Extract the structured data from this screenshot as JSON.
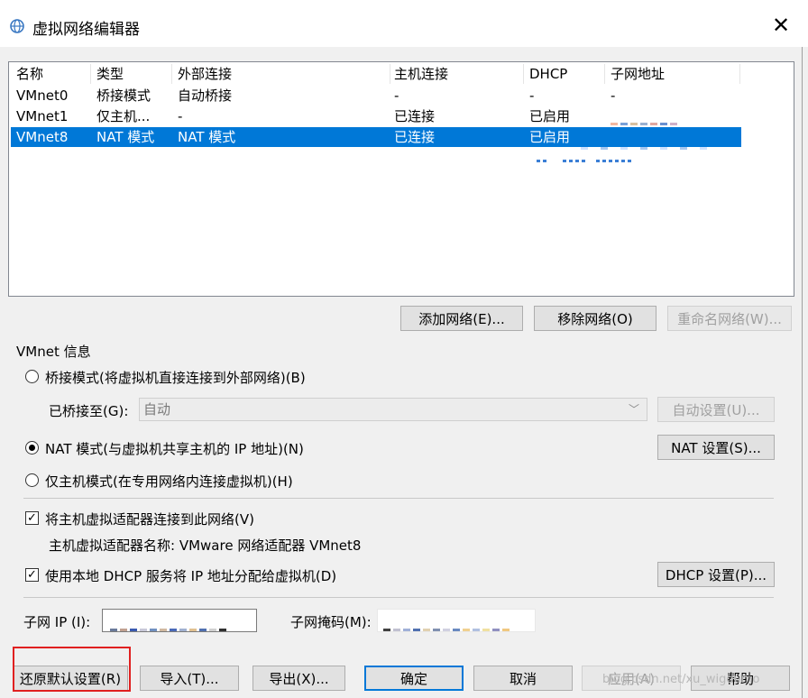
{
  "window": {
    "title": "虚拟网络编辑器",
    "close_glyph": "✕",
    "icon": "network-editor-icon"
  },
  "list": {
    "columns": [
      "名称",
      "类型",
      "外部连接",
      "主机连接",
      "DHCP",
      "子网地址"
    ],
    "rows": [
      {
        "name": "VMnet0",
        "type": "桥接模式",
        "external": "自动桥接",
        "host": "-",
        "dhcp": "-",
        "subnet": "-"
      },
      {
        "name": "VMnet1",
        "type": "仅主机...",
        "external": "-",
        "host": "已连接",
        "dhcp": "已启用",
        "subnet": ""
      },
      {
        "name": "VMnet8",
        "type": "NAT 模式",
        "external": "NAT 模式",
        "host": "已连接",
        "dhcp": "已启用",
        "subnet": ""
      }
    ],
    "selected_index": 2
  },
  "net_buttons": {
    "add": "添加网络(E)...",
    "remove": "移除网络(O)",
    "rename": "重命名网络(W)..."
  },
  "vmnet_info": {
    "group_title": "VMnet 信息",
    "bridge_label": "桥接模式(将虚拟机直接连接到外部网络)(B)",
    "bridged_to_label": "已桥接至(G):",
    "bridged_to_value": "自动",
    "auto_settings": "自动设置(U)...",
    "nat_label": "NAT 模式(与虚拟机共享主机的 IP 地址)(N)",
    "nat_settings": "NAT 设置(S)...",
    "hostonly_label": "仅主机模式(在专用网络内连接虚拟机)(H)",
    "selected_mode": "nat",
    "connect_adapter_label": "将主机虚拟适配器连接到此网络(V)",
    "connect_adapter_checked": true,
    "adapter_name_label": "主机虚拟适配器名称: VMware 网络适配器 VMnet8",
    "dhcp_label": "使用本地 DHCP 服务将 IP 地址分配给虚拟机(D)",
    "dhcp_checked": true,
    "dhcp_settings": "DHCP 设置(P)...",
    "subnet_ip_label": "子网 IP (I):",
    "subnet_mask_label": "子网掩码(M):"
  },
  "footer": {
    "restore": "还原默认设置(R)",
    "import": "导入(T)...",
    "export": "导出(X)...",
    "ok": "确定",
    "cancel": "取消",
    "apply": "应用(A)",
    "help": "帮助",
    "watermark": "blog.csdn.net/xu_wigdumo"
  },
  "colors": {
    "selection": "#0078d7",
    "highlight_box": "#e02020",
    "dialog_bg": "#f0f0f0"
  }
}
